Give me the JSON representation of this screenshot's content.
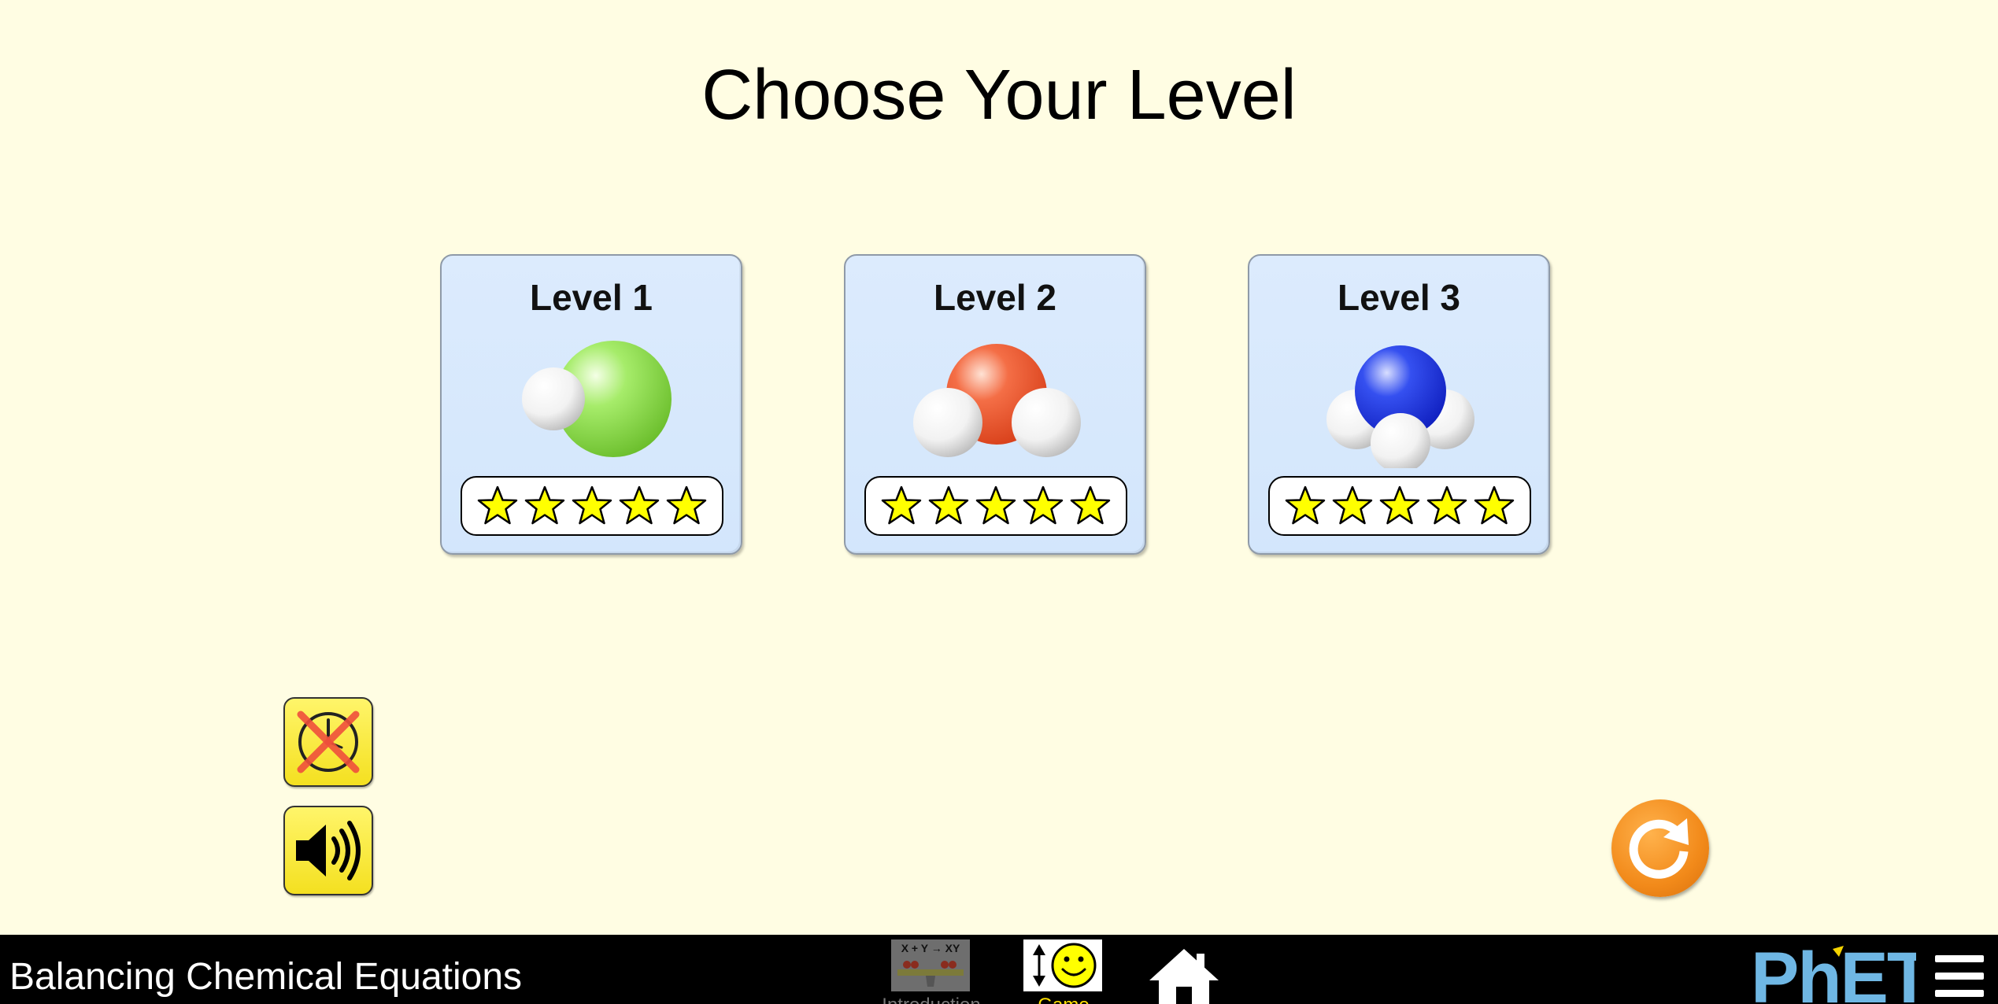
{
  "page": {
    "title": "Choose Your Level"
  },
  "levels": [
    {
      "label": "Level 1",
      "molecule": "HCl-molecule-icon",
      "stars_earned": 5,
      "stars_total": 5
    },
    {
      "label": "Level 2",
      "molecule": "H2O-molecule-icon",
      "stars_earned": 5,
      "stars_total": 5
    },
    {
      "label": "Level 3",
      "molecule": "NH3-molecule-icon",
      "stars_earned": 5,
      "stars_total": 5
    }
  ],
  "controls": {
    "timer_toggle": {
      "icon": "timer-off-icon",
      "state": "off"
    },
    "sound_toggle": {
      "icon": "speaker-on-icon",
      "state": "on"
    },
    "reset_all": {
      "icon": "reset-icon"
    }
  },
  "navbar": {
    "sim_title": "Balancing Chemical Equations",
    "screens": [
      {
        "label": "Introduction",
        "icon_text": "X + Y → XY",
        "selected": false
      },
      {
        "label": "Game",
        "selected": true
      }
    ],
    "home_icon": "home-icon",
    "logo_text": "PhET",
    "menu_icon": "hamburger-menu-icon"
  },
  "colors": {
    "background": "#FFFDE3",
    "card": "#D8E9FC",
    "star": "#FFFF00",
    "button_yellow": "#FFF04A",
    "reset_orange": "#F28A1A",
    "navbar": "#000000",
    "game_label": "#FFE000",
    "phet_blue": "#6FB7E4"
  }
}
